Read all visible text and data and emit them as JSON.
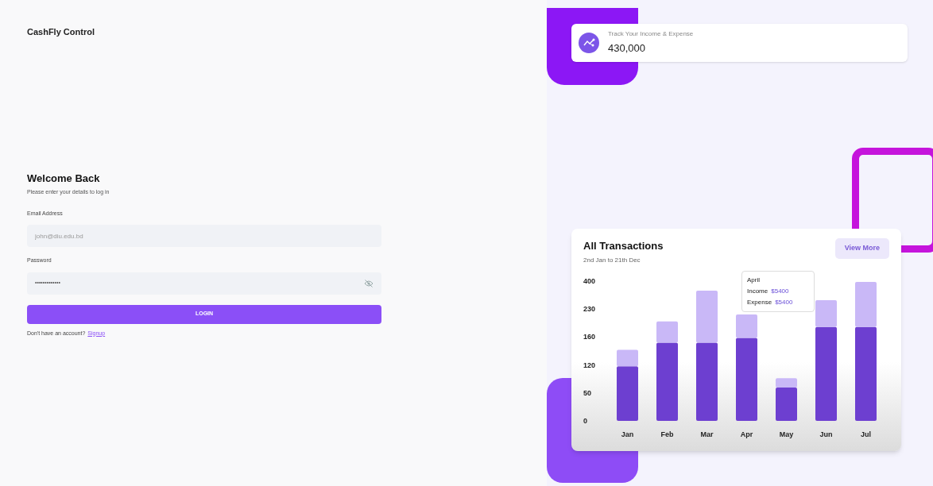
{
  "brand": "CashFly Control",
  "login": {
    "title": "Welcome Back",
    "subtitle": "Please enter your details to log in",
    "email": {
      "label": "Email Address",
      "placeholder": "john@diu.edu.bd"
    },
    "password": {
      "label": "Password",
      "value": "•••••••••••••"
    },
    "button": "LOGIN",
    "signup_prompt": "Don't have an account?",
    "signup_link": "Signup"
  },
  "summary": {
    "label": "Track Your Income & Expense",
    "value": "430,000"
  },
  "transactions": {
    "title": "All Transactions",
    "subtitle": "2nd Jan to 21th Dec",
    "button": "View More",
    "tooltip": {
      "title": "April",
      "rows": [
        {
          "label": "Income",
          "value": "$5400"
        },
        {
          "label": "Expense",
          "value": "$5400"
        }
      ]
    },
    "y_axis_labels": [
      "400",
      "230",
      "160",
      "120",
      "50",
      "0"
    ],
    "x_axis_labels": [
      "Jan",
      "Feb",
      "Mar",
      "Apr",
      "May",
      "Jun",
      "Jul"
    ]
  }
}
